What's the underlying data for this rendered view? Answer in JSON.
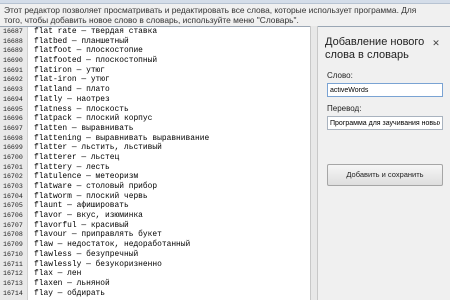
{
  "info": {
    "line1": "Этот редактор позволяет просматривать и редактировать все слова, которые использует программа. Для",
    "line2": "того, чтобы добавить новое слово в словарь, используйте меню \"Словарь\"."
  },
  "dictionary": {
    "rows": [
      {
        "num": "16687",
        "entry": "flat rate — твердая ставка"
      },
      {
        "num": "16688",
        "entry": "flatbed — планшетный"
      },
      {
        "num": "16689",
        "entry": "flatfoot — плоскостопие"
      },
      {
        "num": "16690",
        "entry": "flatfooted — плоскостопный"
      },
      {
        "num": "16691",
        "entry": "flatiron — утюг"
      },
      {
        "num": "16692",
        "entry": "flat-iron — утюг"
      },
      {
        "num": "16693",
        "entry": "flatland — плато"
      },
      {
        "num": "16694",
        "entry": "flatly — наотрез"
      },
      {
        "num": "16695",
        "entry": "flatness — плоскость"
      },
      {
        "num": "16696",
        "entry": "flatpack — плоский корпус"
      },
      {
        "num": "16697",
        "entry": "flatten — выравнивать"
      },
      {
        "num": "16698",
        "entry": "flattening — выравнивать выравнивание"
      },
      {
        "num": "16699",
        "entry": "flatter — льстить, льстивый"
      },
      {
        "num": "16700",
        "entry": "flatterer — льстец"
      },
      {
        "num": "16701",
        "entry": "flattery — лесть"
      },
      {
        "num": "16702",
        "entry": "flatulence — метеоризм"
      },
      {
        "num": "16703",
        "entry": "flatware — столовый прибор"
      },
      {
        "num": "16704",
        "entry": "flatworm — плоский червь"
      },
      {
        "num": "16705",
        "entry": "flaunt — афишировать"
      },
      {
        "num": "16706",
        "entry": "flavor — вкус, изюминка"
      },
      {
        "num": "16707",
        "entry": "flavorful — красивый"
      },
      {
        "num": "16708",
        "entry": "flavour — приправлять букет"
      },
      {
        "num": "16709",
        "entry": "flaw — недостаток, недоработанный"
      },
      {
        "num": "16710",
        "entry": "flawless — безупречный"
      },
      {
        "num": "16711",
        "entry": "flawlessly — безукоризненно"
      },
      {
        "num": "16712",
        "entry": "flax — лен"
      },
      {
        "num": "16713",
        "entry": "flaxen — льняной"
      },
      {
        "num": "16714",
        "entry": "flay — обдирать"
      }
    ]
  },
  "side_panel": {
    "title": "Добавление нового слова в словарь",
    "close_glyph": "✕",
    "word_label": "Слово:",
    "word_value": "activeWords",
    "translation_label": "Перевод:",
    "translation_value": "Программа для заучивания новых слов",
    "submit_label": "Добавить и сохранить"
  }
}
